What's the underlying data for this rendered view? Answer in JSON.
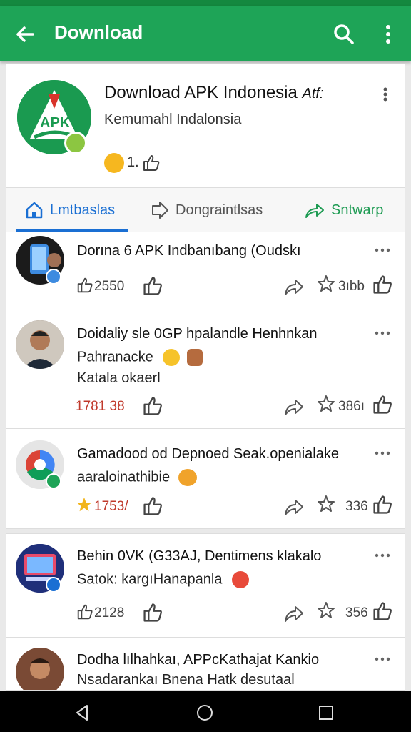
{
  "appbar": {
    "title": "Download"
  },
  "header": {
    "app_name": "Download APK Indonesia",
    "app_name_suffix": "Atf:",
    "subtitle": "Kemumahl Indalonsia",
    "count": "1."
  },
  "tabs": [
    {
      "label": "Lmtbaslas"
    },
    {
      "label": "Dongraintlsas"
    },
    {
      "label": "Sntwarp"
    }
  ],
  "posts": [
    {
      "title": "Dorına 6 APK Indbanıbang (Oudskı",
      "line2": "",
      "line3": "",
      "likes": "2550",
      "stars": "3ıbb"
    },
    {
      "title": "Doidaliy sle 0GP hpalandle Henhnkan",
      "line2": "Pahranacke",
      "line3": "Katala okaerl",
      "likes": "1781 38",
      "stars": "386ı"
    },
    {
      "title": "Gamadood od Depnoed Seak.openialake",
      "line2": "aaraloinathibie",
      "line3": "",
      "likes": "1753/",
      "stars": "336"
    },
    {
      "title": "Behin 0VK (G33AJ, Dentimens klakalo",
      "line2": "Satok: kargıHanapanla",
      "line3": "",
      "likes": "2128",
      "stars": "356"
    },
    {
      "title": "Dodha lılhahkaı, APPcKathajat Kankio",
      "line2": "Nsadarankaı Bnena Hatk desutaal",
      "line3": "",
      "likes": "",
      "stars": ""
    }
  ],
  "colors": {
    "appbar": "#1ea457",
    "tab_active": "#1a6fd3",
    "tab_green": "#1e9b53",
    "emoji": "#f6b71f"
  }
}
